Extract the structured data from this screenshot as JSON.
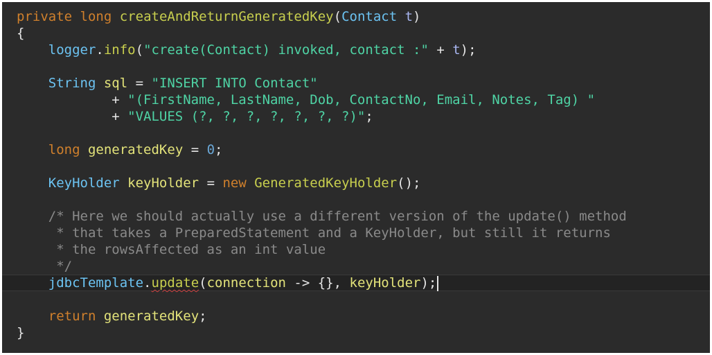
{
  "editor": {
    "lines": [
      {
        "tokens": [
          {
            "t": "*/",
            "c": "cm"
          }
        ]
      },
      {
        "tokens": [
          {
            "t": "private",
            "c": "kw"
          },
          {
            "t": " ",
            "c": "pl"
          },
          {
            "t": "long",
            "c": "kw"
          },
          {
            "t": " ",
            "c": "pl"
          },
          {
            "t": "createAndReturnGeneratedKey",
            "c": "fn"
          },
          {
            "t": "(",
            "c": "pl"
          },
          {
            "t": "Contact",
            "c": "ty"
          },
          {
            "t": " ",
            "c": "pl"
          },
          {
            "t": "t",
            "c": "pm"
          },
          {
            "t": ")",
            "c": "pl"
          }
        ]
      },
      {
        "tokens": [
          {
            "t": "{",
            "c": "pl"
          }
        ]
      },
      {
        "tokens": [
          {
            "t": "    ",
            "c": "pl"
          },
          {
            "t": "logger",
            "c": "ty"
          },
          {
            "t": ".",
            "c": "pl"
          },
          {
            "t": "info",
            "c": "fn"
          },
          {
            "t": "(",
            "c": "pl"
          },
          {
            "t": "\"create(Contact) invoked, contact :\"",
            "c": "st"
          },
          {
            "t": " + ",
            "c": "pl"
          },
          {
            "t": "t",
            "c": "pm"
          },
          {
            "t": ");",
            "c": "pl"
          }
        ]
      },
      {
        "tokens": []
      },
      {
        "tokens": [
          {
            "t": "    ",
            "c": "pl"
          },
          {
            "t": "String",
            "c": "ty"
          },
          {
            "t": " ",
            "c": "pl"
          },
          {
            "t": "sql",
            "c": "id"
          },
          {
            "t": " = ",
            "c": "pl"
          },
          {
            "t": "\"INSERT INTO Contact\"",
            "c": "st"
          }
        ]
      },
      {
        "tokens": [
          {
            "t": "            + ",
            "c": "pl"
          },
          {
            "t": "\"(FirstName, LastName, Dob, ContactNo, Email, Notes, Tag) \"",
            "c": "st"
          }
        ]
      },
      {
        "tokens": [
          {
            "t": "            + ",
            "c": "pl"
          },
          {
            "t": "\"VALUES (?, ?, ?, ?, ?, ?, ?)\"",
            "c": "st"
          },
          {
            "t": ";",
            "c": "pl"
          }
        ]
      },
      {
        "tokens": []
      },
      {
        "tokens": [
          {
            "t": "    ",
            "c": "pl"
          },
          {
            "t": "long",
            "c": "kw"
          },
          {
            "t": " ",
            "c": "pl"
          },
          {
            "t": "generatedKey",
            "c": "id"
          },
          {
            "t": " = ",
            "c": "pl"
          },
          {
            "t": "0",
            "c": "nu"
          },
          {
            "t": ";",
            "c": "pl"
          }
        ]
      },
      {
        "tokens": []
      },
      {
        "tokens": [
          {
            "t": "    ",
            "c": "pl"
          },
          {
            "t": "KeyHolder",
            "c": "ty"
          },
          {
            "t": " ",
            "c": "pl"
          },
          {
            "t": "keyHolder",
            "c": "id"
          },
          {
            "t": " = ",
            "c": "pl"
          },
          {
            "t": "new",
            "c": "kw"
          },
          {
            "t": " ",
            "c": "pl"
          },
          {
            "t": "GeneratedKeyHolder",
            "c": "fn"
          },
          {
            "t": "();",
            "c": "pl"
          }
        ]
      },
      {
        "tokens": []
      },
      {
        "tokens": [
          {
            "t": "    ",
            "c": "pl"
          },
          {
            "t": "/* Here we should actually use a different version of the update() method",
            "c": "cm"
          }
        ]
      },
      {
        "tokens": [
          {
            "t": "     ",
            "c": "pl"
          },
          {
            "t": "* that takes a PreparedStatement and a KeyHolder, but still it returns",
            "c": "cm"
          }
        ]
      },
      {
        "tokens": [
          {
            "t": "     ",
            "c": "pl"
          },
          {
            "t": "* the rowsAffected as an int value",
            "c": "cm"
          }
        ]
      },
      {
        "tokens": [
          {
            "t": "     ",
            "c": "pl"
          },
          {
            "t": "*/",
            "c": "cm"
          }
        ]
      },
      {
        "current": true,
        "tokens": [
          {
            "t": "    ",
            "c": "pl"
          },
          {
            "t": "jdbcTemplate",
            "c": "ty"
          },
          {
            "t": ".",
            "c": "pl"
          },
          {
            "t": "update",
            "c": "fn",
            "squiggle": true
          },
          {
            "t": "(",
            "c": "pl"
          },
          {
            "t": "connection",
            "c": "id"
          },
          {
            "t": " -> {}, ",
            "c": "pl"
          },
          {
            "t": "keyHolder",
            "c": "id"
          },
          {
            "t": ");",
            "c": "pl"
          }
        ]
      },
      {
        "tokens": []
      },
      {
        "tokens": [
          {
            "t": "    ",
            "c": "pl"
          },
          {
            "t": "return",
            "c": "kw"
          },
          {
            "t": " ",
            "c": "pl"
          },
          {
            "t": "generatedKey",
            "c": "id"
          },
          {
            "t": ";",
            "c": "pl"
          }
        ]
      },
      {
        "tokens": [
          {
            "t": "}",
            "c": "pl"
          }
        ]
      }
    ]
  }
}
